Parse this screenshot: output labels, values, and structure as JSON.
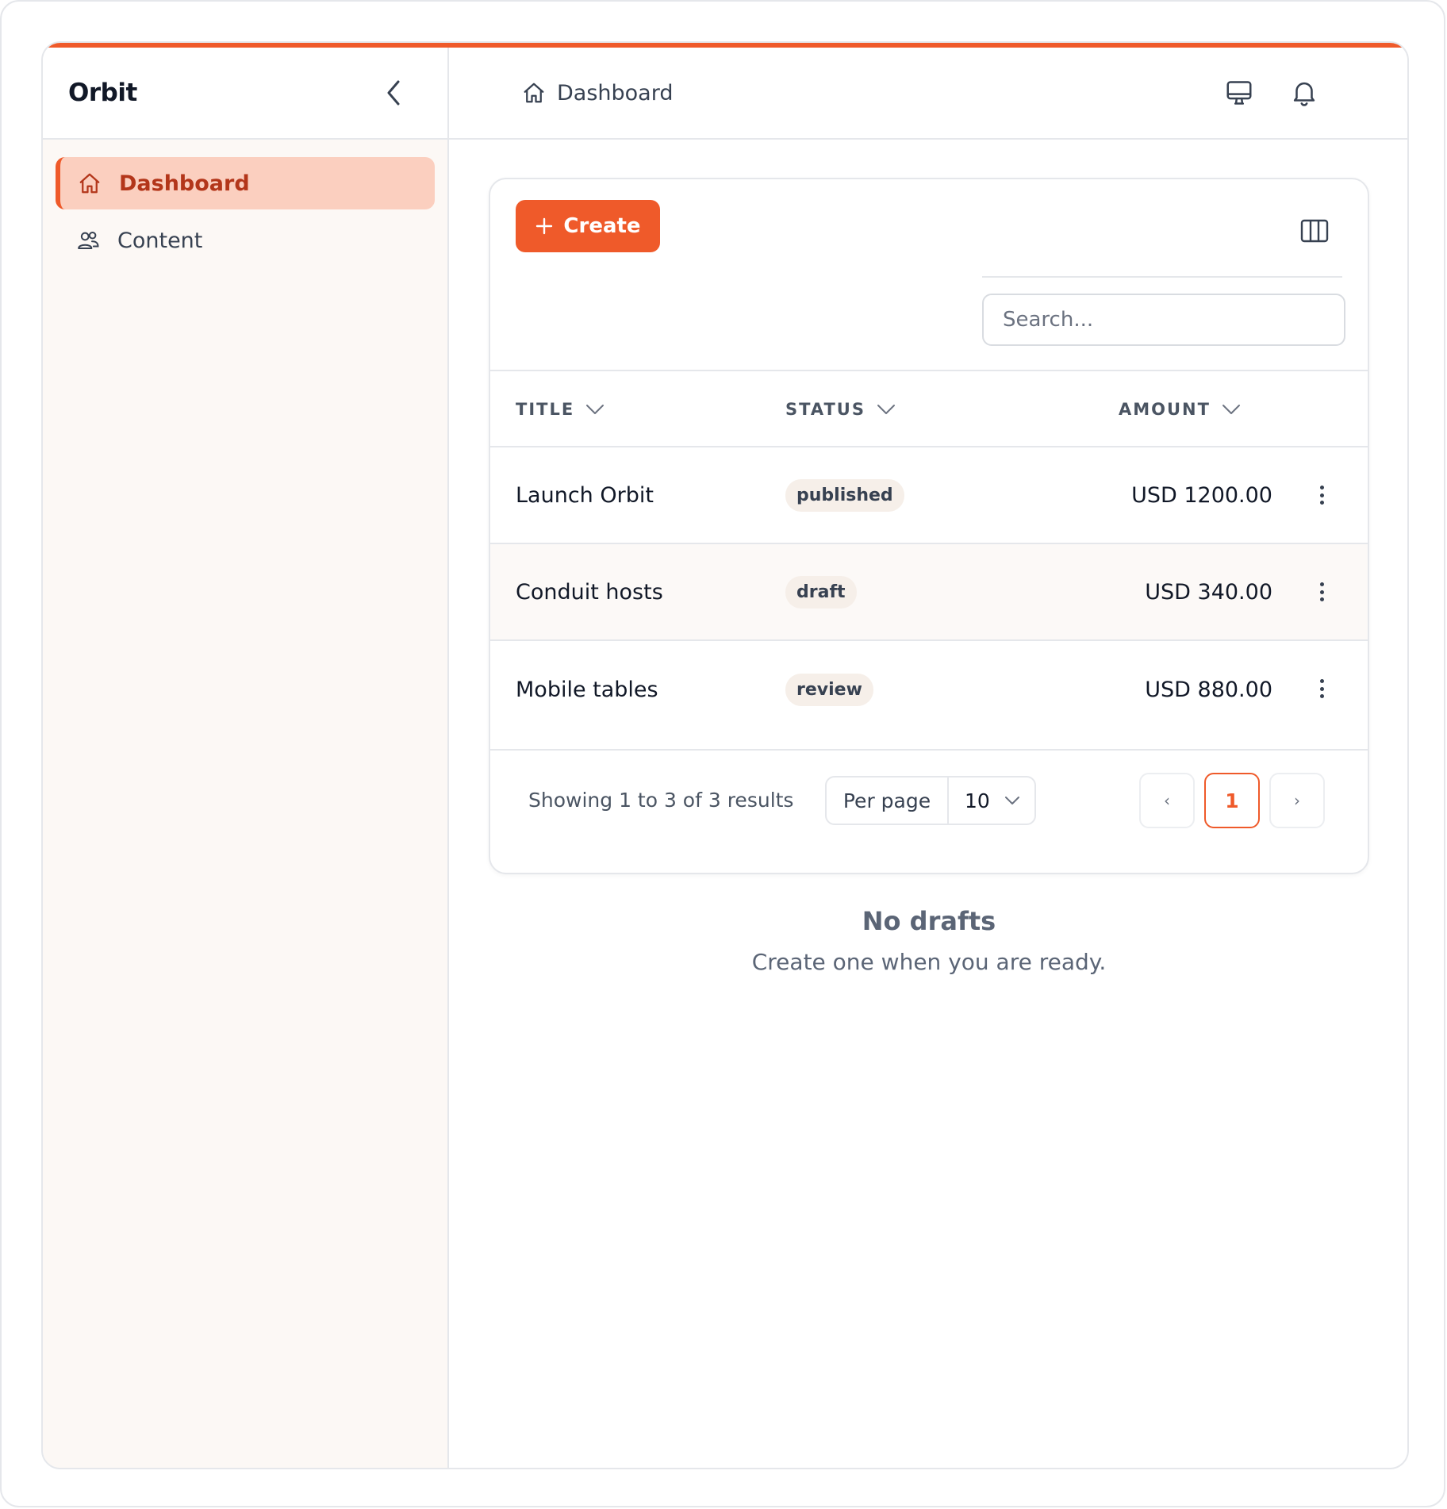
{
  "sidebar": {
    "brand": "Orbit",
    "items": [
      {
        "label": "Dashboard",
        "icon": "home-icon",
        "active": true
      },
      {
        "label": "Content",
        "icon": "users-icon",
        "active": false
      }
    ]
  },
  "header": {
    "breadcrumb": "Dashboard"
  },
  "toolbar": {
    "create_label": "Create",
    "search_placeholder": "Search..."
  },
  "table": {
    "columns": [
      "TITLE",
      "STATUS",
      "AMOUNT"
    ],
    "rows": [
      {
        "title": "Launch Orbit",
        "status": "published",
        "amount": "USD 1200.00"
      },
      {
        "title": "Conduit hosts",
        "status": "draft",
        "amount": "USD 340.00"
      },
      {
        "title": "Mobile tables",
        "status": "review",
        "amount": "USD 880.00"
      }
    ]
  },
  "pagination": {
    "showing": "Showing 1 to 3 of 3 results",
    "per_page_label": "Per page",
    "per_page_value": "10",
    "prev": "‹",
    "current": "1",
    "next": "›"
  },
  "empty_state": {
    "title": "No drafts",
    "subtitle": "Create one when you are ready."
  },
  "colors": {
    "accent": "#ef5a2a",
    "active_bg": "#fbcfbf",
    "active_text": "#b3361a"
  }
}
